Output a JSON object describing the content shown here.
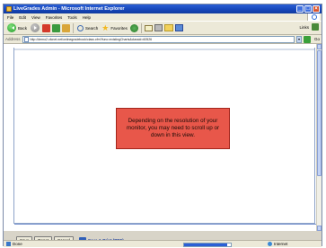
{
  "window": {
    "title": "LiveGrades Admin - Microsoft Internet Explorer"
  },
  "menu": {
    "items": [
      "File",
      "Edit",
      "View",
      "Favorites",
      "Tools",
      "Help"
    ]
  },
  "toolbar": {
    "back_label": "Back",
    "search_label": "Search",
    "favorites_label": "Favorites",
    "links_label": "Links"
  },
  "address": {
    "label": "Address",
    "url": "http://demo2.cfcnet.net/onlinegradebook/class.cfm?func=existingCharts&classid=60526",
    "go_label": "Go"
  },
  "content": {
    "notice": "Depending on the resolution of your monitor, you may need to scroll up or down in this view."
  },
  "actions": {
    "save": "Save",
    "reset": "Reset",
    "cancel": "Cancel",
    "save_print": "Save & Print (PDF)"
  },
  "status": {
    "text": "Done",
    "zone": "Internet",
    "progress": 0.92
  },
  "colors": {
    "notice_bg": "#e8574a",
    "title_bar": "#1545b8"
  }
}
